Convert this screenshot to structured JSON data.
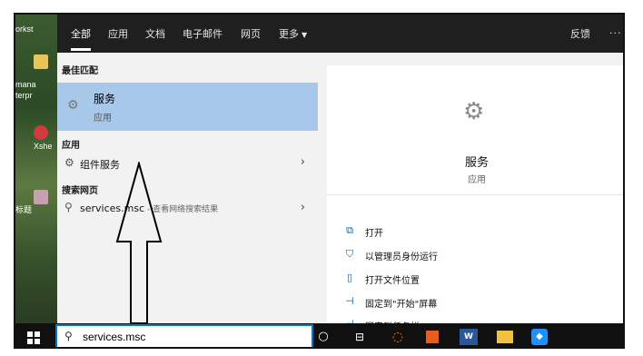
{
  "desktop": {
    "labels": [
      "orkst",
      "mana",
      "terpr",
      "Xshe",
      "标题"
    ]
  },
  "topbar": {
    "tabs": [
      {
        "label": "全部"
      },
      {
        "label": "应用"
      },
      {
        "label": "文档"
      },
      {
        "label": "电子邮件"
      },
      {
        "label": "网页"
      },
      {
        "label": "更多"
      }
    ],
    "feedback": "反馈",
    "more_dots": "···"
  },
  "left": {
    "best_match_heading": "最佳匹配",
    "best_match": {
      "title": "服务",
      "subtitle": "应用",
      "icon": "gear-icon"
    },
    "apps_heading": "应用",
    "apps": [
      {
        "label": "组件服务",
        "icon": "component-services-icon"
      }
    ],
    "web_heading": "搜索网页",
    "web": [
      {
        "query": "services.msc",
        "hint": " - 查看网络搜索结果",
        "icon": "search-icon"
      }
    ]
  },
  "right": {
    "title": "服务",
    "subtitle": "应用",
    "actions": [
      {
        "label": "打开",
        "icon": "open-icon"
      },
      {
        "label": "以管理员身份运行",
        "icon": "shield-icon"
      },
      {
        "label": "打开文件位置",
        "icon": "file-location-icon"
      },
      {
        "label": "固定到\"开始\"屏幕",
        "icon": "pin-icon"
      },
      {
        "label": "固定到任务栏",
        "icon": "pin-icon"
      }
    ]
  },
  "taskbar": {
    "search_value": "services.msc"
  },
  "colors": {
    "selection": "#a7c8e8",
    "accent": "#0078d7",
    "topbar": "#1f1f1f",
    "taskbar": "#101010"
  }
}
